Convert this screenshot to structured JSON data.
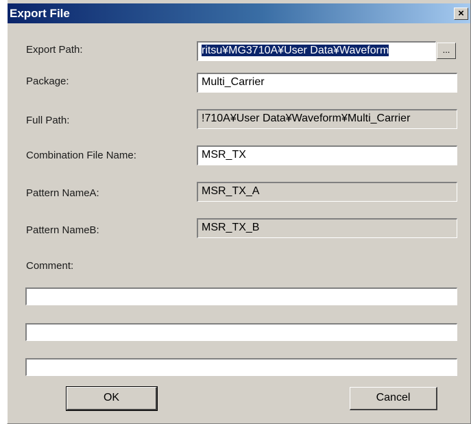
{
  "dialog": {
    "title": "Export File",
    "close_symbol": "×"
  },
  "fields": {
    "export_path": {
      "label": "Export Path:",
      "value": "ritsu¥MG3710A¥User Data¥Waveform",
      "browse_label": "..."
    },
    "package": {
      "label": "Package:",
      "value": "Multi_Carrier"
    },
    "full_path": {
      "label": "Full Path:",
      "value": "!710A¥User Data¥Waveform¥Multi_Carrier"
    },
    "combination_file_name": {
      "label": "Combination File Name:",
      "value": "MSR_TX"
    },
    "pattern_name_a": {
      "label": "Pattern NameA:",
      "value": "MSR_TX_A"
    },
    "pattern_name_b": {
      "label": "Pattern NameB:",
      "value": "MSR_TX_B"
    },
    "comment": {
      "label": "Comment:",
      "lines": [
        "",
        "",
        ""
      ]
    }
  },
  "buttons": {
    "ok": "OK",
    "cancel": "Cancel"
  },
  "colors": {
    "titlebar_start": "#0a246a",
    "titlebar_end": "#a6caf0",
    "dialog_face": "#d4d0c8",
    "selection": "#0a246a"
  }
}
